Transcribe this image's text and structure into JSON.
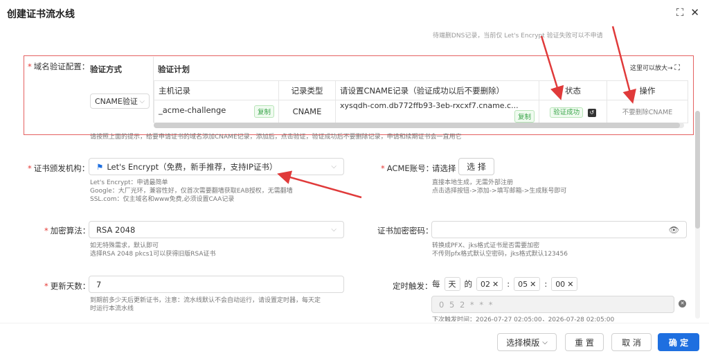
{
  "dialog": {
    "title": "创建证书流水线",
    "faded_top_text": "待端删DNS记录，当前仅 Let's Encrypt 验证失败可以不申请"
  },
  "domain_verify": {
    "label": "域名验证配置：",
    "col_method": "验证方式",
    "col_plan": "验证计划",
    "zoom_hint": "这里可以放大→",
    "method_select": "CNAME验证",
    "columns": [
      "主机记录",
      "记录类型",
      "请设置CNAME记录（验证成功以后不要删除）",
      "状态",
      "操作"
    ],
    "row": {
      "host": "_acme-challenge",
      "copy1": "复制",
      "type": "CNAME",
      "cname": "xysqdh-com.db772ffb93-3eb-rxcxf7.cname.c...",
      "copy2": "复制",
      "status": "验证成功",
      "action": "不要删除CNAME"
    },
    "hint": "请按照上面的提示，给要申请证书的域名添加CNAME记录，添加后，点击验证，验证成功后不要删除记录，申请和续期证书会一直用它"
  },
  "issuer": {
    "label": "证书颁发机构：",
    "value": "Let's Encrypt（免费，新手推荐，支持IP证书）",
    "hints": [
      "Let's Encrypt：申请最简单",
      "Google：大厂光环，兼容性好，仅首次需要翻墙获取EAB授权，无需翻墙",
      "SSL.com：仅主域名和www免费,必须设置CAA记录"
    ]
  },
  "acme": {
    "label": "ACME账号：",
    "value": "请选择",
    "button": "选 择",
    "hints": [
      "直接本地生成，无需外部注册",
      "点击选择按钮->添加->填写邮箱->生成账号即可"
    ]
  },
  "algorithm": {
    "label": "加密算法：",
    "value": "RSA 2048",
    "hints": [
      "如无特殊需求，默认即可",
      "选择RSA 2048 pkcs1可以获得旧版RSA证书"
    ]
  },
  "cert_password": {
    "label": "证书加密密码：",
    "hints": [
      "转换成PFX、jks格式证书是否需要加密",
      "不传则pfx格式默认空密码，jks格式默认123456"
    ]
  },
  "renew_days": {
    "label": "更新天数：",
    "value": "7",
    "hints": [
      "到期前多少天后更新证书，注意：流水线默认不会自动运行，请设置定时器，每天定",
      "时运行本流水线"
    ]
  },
  "schedule": {
    "label": "定时触发：",
    "every": "每",
    "unit": "天",
    "of": "的",
    "hour": "02",
    "minute": "05",
    "second": "00",
    "sep": ":",
    "cron": "0 5 2 * * *",
    "next_run": "下次触发时间：2026-07-27 02:05:00，2026-07-28 02:05:00"
  },
  "footer": {
    "template_btn": "选择模版",
    "reset_btn": "重 置",
    "cancel_btn": "取 消",
    "ok_btn": "确 定"
  },
  "colors": {
    "primary": "#1e6fe0",
    "required": "#e53935",
    "success": "#3aa54a",
    "annotation": "#e46060"
  }
}
